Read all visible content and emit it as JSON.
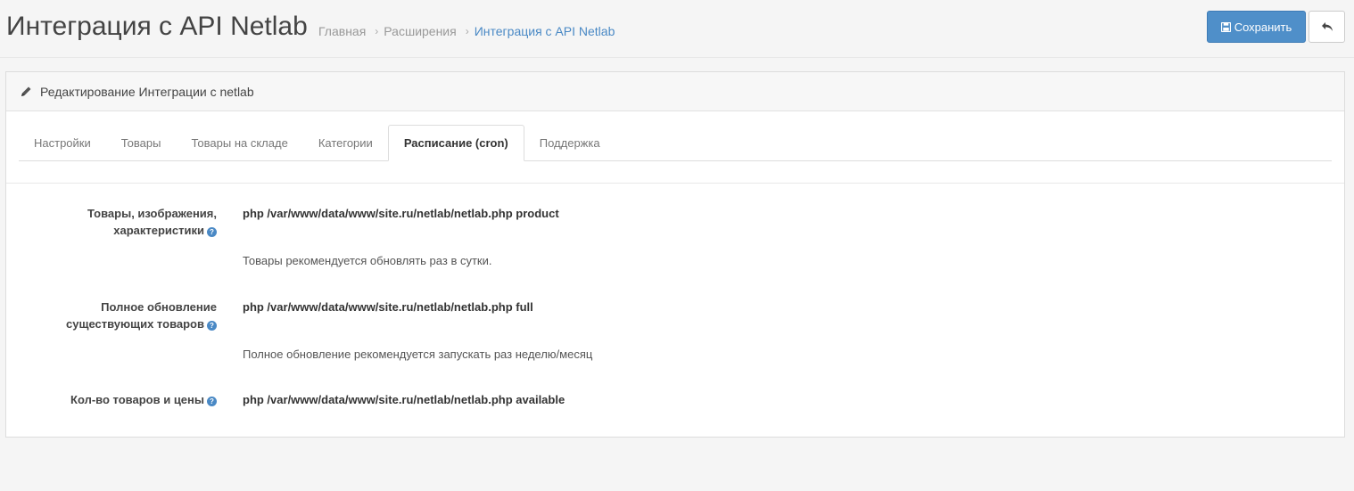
{
  "header": {
    "title": "Интеграция с API Netlab",
    "breadcrumb": [
      {
        "label": "Главная"
      },
      {
        "label": "Расширения"
      },
      {
        "label": "Интеграция с API Netlab"
      }
    ],
    "save_label": "Сохранить",
    "save_icon": "floppy-disk-icon",
    "back_icon": "reply-icon"
  },
  "panel": {
    "title": "Редактирование Интеграции с netlab",
    "title_icon": "pencil-icon"
  },
  "tabs": [
    {
      "label": "Настройки"
    },
    {
      "label": "Товары"
    },
    {
      "label": "Товары на складе"
    },
    {
      "label": "Категории"
    },
    {
      "label": "Расписание (cron)",
      "active": true
    },
    {
      "label": "Поддержка"
    }
  ],
  "cron": {
    "products": {
      "label_line1": "Товары, изображения,",
      "label_line2": "характеристики",
      "command": "php /var/www/data/www/site.ru/netlab/netlab.php product",
      "hint": "Товары рекомендуется обновлять раз в сутки."
    },
    "full": {
      "label_line1": "Полное обновление",
      "label_line2": "существующих товаров",
      "command": "php /var/www/data/www/site.ru/netlab/netlab.php full",
      "hint": "Полное обновление рекомендуется запускать раз неделю/месяц"
    },
    "available": {
      "label": "Кол-во товаров и цены",
      "command": "php /var/www/data/www/site.ru/netlab/netlab.php available"
    },
    "help_glyph": "?"
  },
  "colors": {
    "primary": "#4f8fc9",
    "link": "#4a89c5"
  }
}
